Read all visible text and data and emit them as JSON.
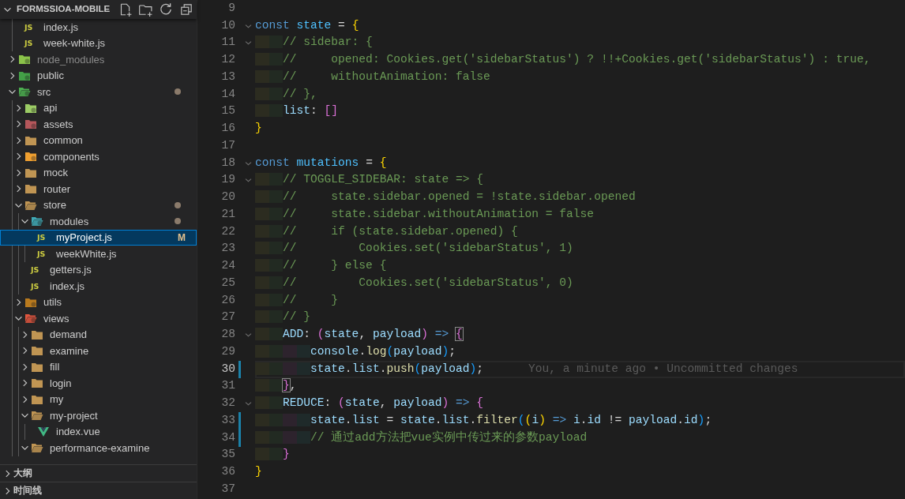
{
  "explorer": {
    "title": "FORMSSIOA-MOBILE",
    "expanded": true,
    "tree": [
      {
        "children": [
          {
            "kind": "js",
            "name": "index.js",
            "icon_label": "JS",
            "selected": false
          },
          {
            "kind": "js",
            "name": "week-white.js",
            "icon_label": "JS",
            "selected": false
          }
        ]
      },
      {
        "kind": "node",
        "name": "node_modules",
        "expanded": false,
        "ignored": true,
        "selected": false
      },
      {
        "kind": "public",
        "name": "public",
        "expanded": false,
        "selected": false
      },
      {
        "kind": "src",
        "name": "src",
        "expanded": true,
        "has_changes": true,
        "selected": false,
        "children": [
          {
            "kind": "api",
            "name": "api",
            "expanded": false,
            "selected": false
          },
          {
            "kind": "assets",
            "name": "assets",
            "expanded": false,
            "selected": false
          },
          {
            "kind": "folder",
            "name": "common",
            "expanded": false,
            "selected": false
          },
          {
            "kind": "components",
            "name": "components",
            "expanded": false,
            "selected": false
          },
          {
            "kind": "folder",
            "name": "mock",
            "expanded": false,
            "selected": false
          },
          {
            "kind": "folder",
            "name": "router",
            "expanded": false,
            "selected": false
          },
          {
            "kind": "folder",
            "name": "store",
            "expanded": true,
            "has_changes": true,
            "selected": false,
            "children": [
              {
                "kind": "modules",
                "name": "modules",
                "expanded": true,
                "has_changes": true,
                "selected": false,
                "children": [
                  {
                    "kind": "js",
                    "name": "myProject.js",
                    "icon_label": "JS",
                    "git_status": "M",
                    "selected": true
                  },
                  {
                    "kind": "js",
                    "name": "weekWhite.js",
                    "icon_label": "JS",
                    "selected": false
                  }
                ]
              },
              {
                "kind": "js",
                "name": "getters.js",
                "icon_label": "JS",
                "selected": false
              },
              {
                "kind": "js",
                "name": "index.js",
                "icon_label": "JS",
                "selected": false
              }
            ]
          },
          {
            "kind": "utils",
            "name": "utils",
            "expanded": false,
            "selected": false
          },
          {
            "kind": "views",
            "name": "views",
            "expanded": true,
            "selected": false,
            "children": [
              {
                "kind": "folder",
                "name": "demand",
                "expanded": false,
                "selected": false
              },
              {
                "kind": "folder",
                "name": "examine",
                "expanded": false,
                "selected": false
              },
              {
                "kind": "folder",
                "name": "fill",
                "expanded": false,
                "selected": false
              },
              {
                "kind": "folder",
                "name": "login",
                "expanded": false,
                "selected": false
              },
              {
                "kind": "folder",
                "name": "my",
                "expanded": false,
                "selected": false
              },
              {
                "kind": "folder",
                "name": "my-project",
                "expanded": true,
                "selected": false,
                "children": [
                  {
                    "kind": "vue",
                    "name": "index.vue",
                    "selected": false
                  }
                ]
              },
              {
                "kind": "folder",
                "name": "performance-examine",
                "expanded": true,
                "selected": false
              }
            ]
          }
        ]
      }
    ]
  },
  "panels": [
    {
      "title": "大纲",
      "expanded": false
    },
    {
      "title": "时间线",
      "expanded": false
    }
  ],
  "editor": {
    "lines": [
      {
        "number": "9"
      },
      {
        "number": "10",
        "foldable": true,
        "tokens": [
          {
            "text": "const ",
            "kind": "kw"
          },
          {
            "text": "state",
            "kind": "const"
          },
          {
            "text": " = ",
            "kind": "plain"
          },
          {
            "text": "{",
            "kind": "b1"
          }
        ]
      },
      {
        "number": "11",
        "foldable": true,
        "tokens": [
          {
            "text": "    // sidebar: {",
            "kind": "comment"
          }
        ]
      },
      {
        "number": "12",
        "tokens": [
          {
            "text": "    //     opened: Cookies.get('sidebarStatus') ? !!+Cookies.get('sidebarStatus') : true,",
            "kind": "comment"
          }
        ]
      },
      {
        "number": "13",
        "tokens": [
          {
            "text": "    //     withoutAnimation: false",
            "kind": "comment"
          }
        ]
      },
      {
        "number": "14",
        "tokens": [
          {
            "text": "    // },",
            "kind": "comment"
          }
        ]
      },
      {
        "number": "15",
        "tokens": [
          {
            "text": "    list",
            "kind": "var"
          },
          {
            "text": ": ",
            "kind": "plain"
          },
          {
            "text": "[]",
            "kind": "b2"
          }
        ]
      },
      {
        "number": "16",
        "tokens": [
          {
            "text": "}",
            "kind": "b1"
          }
        ]
      },
      {
        "number": "17"
      },
      {
        "number": "18",
        "foldable": true,
        "tokens": [
          {
            "text": "const ",
            "kind": "kw"
          },
          {
            "text": "mutations",
            "kind": "const"
          },
          {
            "text": " = ",
            "kind": "plain"
          },
          {
            "text": "{",
            "kind": "b1"
          }
        ]
      },
      {
        "number": "19",
        "foldable": true,
        "tokens": [
          {
            "text": "    // TOGGLE_SIDEBAR: state => {",
            "kind": "comment"
          }
        ]
      },
      {
        "number": "20",
        "tokens": [
          {
            "text": "    //     state.sidebar.opened = !state.sidebar.opened",
            "kind": "comment"
          }
        ]
      },
      {
        "number": "21",
        "tokens": [
          {
            "text": "    //     state.sidebar.withoutAnimation = false",
            "kind": "comment"
          }
        ]
      },
      {
        "number": "22",
        "tokens": [
          {
            "text": "    //     if (state.sidebar.opened) {",
            "kind": "comment"
          }
        ]
      },
      {
        "number": "23",
        "tokens": [
          {
            "text": "    //         Cookies.set('sidebarStatus', 1)",
            "kind": "comment"
          }
        ]
      },
      {
        "number": "24",
        "tokens": [
          {
            "text": "    //     } else {",
            "kind": "comment"
          }
        ]
      },
      {
        "number": "25",
        "tokens": [
          {
            "text": "    //         Cookies.set('sidebarStatus', 0)",
            "kind": "comment"
          }
        ]
      },
      {
        "number": "26",
        "tokens": [
          {
            "text": "    //     }",
            "kind": "comment"
          }
        ]
      },
      {
        "number": "27",
        "tokens": [
          {
            "text": "    // }",
            "kind": "comment"
          }
        ]
      },
      {
        "number": "28",
        "foldable": true,
        "tokens": [
          {
            "text": "    ADD",
            "kind": "var"
          },
          {
            "text": ": ",
            "kind": "plain"
          },
          {
            "text": "(",
            "kind": "b2"
          },
          {
            "text": "state",
            "kind": "var"
          },
          {
            "text": ", ",
            "kind": "plain"
          },
          {
            "text": "payload",
            "kind": "var"
          },
          {
            "text": ") ",
            "kind": "b2"
          },
          {
            "text": "=> ",
            "kind": "kw"
          },
          {
            "text": "{",
            "kind": "b2",
            "matched": true
          }
        ]
      },
      {
        "number": "29",
        "tokens": [
          {
            "text": "        console",
            "kind": "var"
          },
          {
            "text": ".",
            "kind": "plain"
          },
          {
            "text": "log",
            "kind": "fn"
          },
          {
            "text": "(",
            "kind": "b3"
          },
          {
            "text": "payload",
            "kind": "var"
          },
          {
            "text": ")",
            "kind": "b3"
          },
          {
            "text": ";",
            "kind": "plain"
          }
        ]
      },
      {
        "number": "30",
        "current": true,
        "changed": true,
        "blame": "You, a minute ago • Uncommitted changes",
        "tokens": [
          {
            "text": "        state",
            "kind": "var"
          },
          {
            "text": ".",
            "kind": "plain"
          },
          {
            "text": "list",
            "kind": "var"
          },
          {
            "text": ".",
            "kind": "plain"
          },
          {
            "text": "push",
            "kind": "fn"
          },
          {
            "text": "(",
            "kind": "b3"
          },
          {
            "text": "payload",
            "kind": "var"
          },
          {
            "text": ")",
            "kind": "b3"
          },
          {
            "text": ";",
            "kind": "plain"
          }
        ]
      },
      {
        "number": "31",
        "tokens": [
          {
            "text": "    }",
            "kind": "b2",
            "matched": true
          },
          {
            "text": ",",
            "kind": "plain"
          }
        ]
      },
      {
        "number": "32",
        "foldable": true,
        "tokens": [
          {
            "text": "    REDUCE",
            "kind": "var"
          },
          {
            "text": ": ",
            "kind": "plain"
          },
          {
            "text": "(",
            "kind": "b2"
          },
          {
            "text": "state",
            "kind": "var"
          },
          {
            "text": ", ",
            "kind": "plain"
          },
          {
            "text": "payload",
            "kind": "var"
          },
          {
            "text": ") ",
            "kind": "b2"
          },
          {
            "text": "=> ",
            "kind": "kw"
          },
          {
            "text": "{",
            "kind": "b2"
          }
        ]
      },
      {
        "number": "33",
        "changed": true,
        "tokens": [
          {
            "text": "        state",
            "kind": "var"
          },
          {
            "text": ".",
            "kind": "plain"
          },
          {
            "text": "list",
            "kind": "var"
          },
          {
            "text": " = ",
            "kind": "plain"
          },
          {
            "text": "state",
            "kind": "var"
          },
          {
            "text": ".",
            "kind": "plain"
          },
          {
            "text": "list",
            "kind": "var"
          },
          {
            "text": ".",
            "kind": "plain"
          },
          {
            "text": "filter",
            "kind": "fn"
          },
          {
            "text": "(",
            "kind": "b3"
          },
          {
            "text": "(",
            "kind": "b1"
          },
          {
            "text": "i",
            "kind": "var"
          },
          {
            "text": ") ",
            "kind": "b1"
          },
          {
            "text": "=> ",
            "kind": "kw"
          },
          {
            "text": "i",
            "kind": "var"
          },
          {
            "text": ".",
            "kind": "plain"
          },
          {
            "text": "id",
            "kind": "var"
          },
          {
            "text": " != ",
            "kind": "plain"
          },
          {
            "text": "payload",
            "kind": "var"
          },
          {
            "text": ".",
            "kind": "plain"
          },
          {
            "text": "id",
            "kind": "var"
          },
          {
            "text": ")",
            "kind": "b3"
          },
          {
            "text": ";",
            "kind": "plain"
          }
        ]
      },
      {
        "number": "34",
        "changed": true,
        "tokens": [
          {
            "text": "        // 通过add方法把vue实例中传过来的参数payload",
            "kind": "comment"
          }
        ]
      },
      {
        "number": "35",
        "tokens": [
          {
            "text": "    }",
            "kind": "b2"
          }
        ]
      },
      {
        "number": "36",
        "tokens": [
          {
            "text": "}",
            "kind": "b1"
          }
        ]
      },
      {
        "number": "37"
      }
    ]
  }
}
